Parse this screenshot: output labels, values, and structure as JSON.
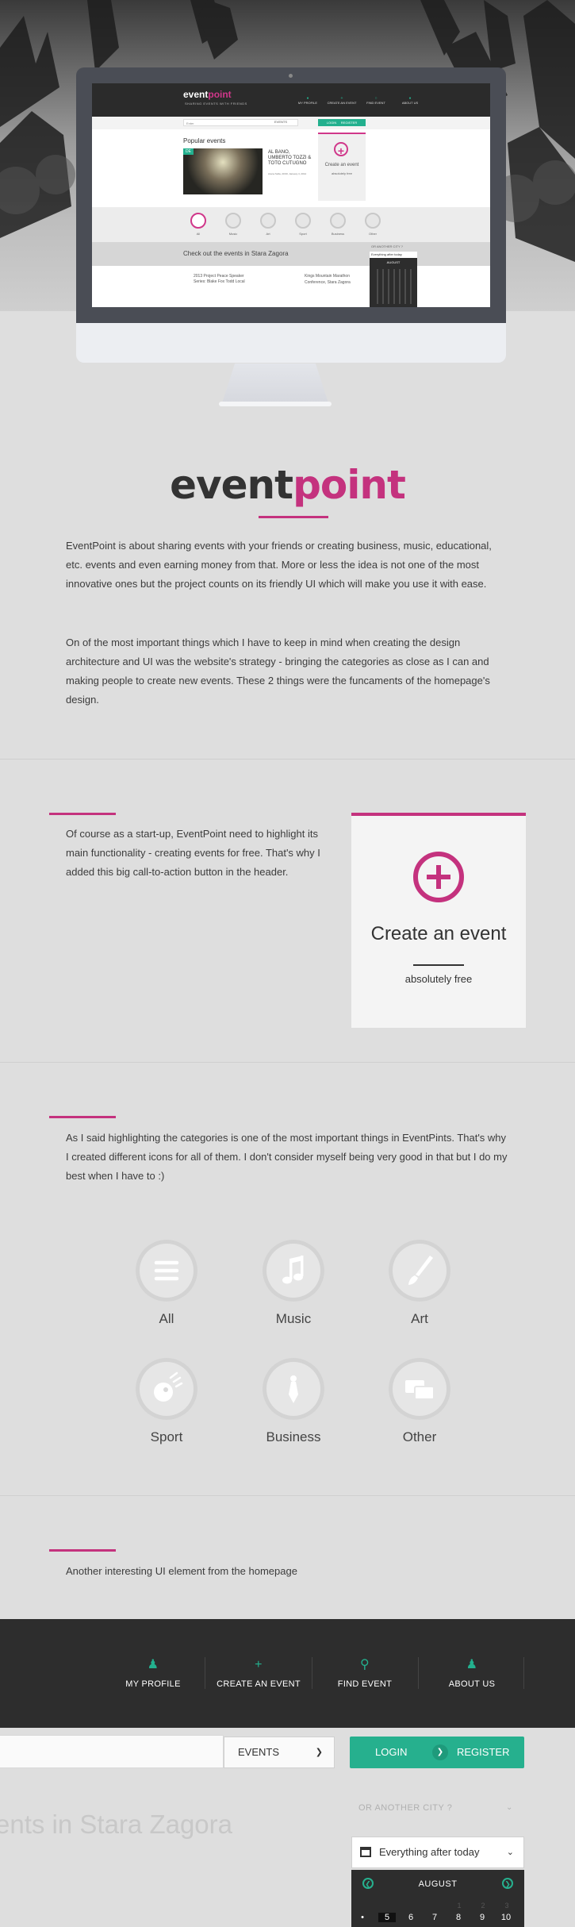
{
  "screen": {
    "logo_main": "event",
    "logo_accent": "point",
    "tagline": "SHARING EVENTS WITH FRIENDS",
    "nav": [
      {
        "label": "MY PROFILE"
      },
      {
        "label": "CREATE AN EVENT"
      },
      {
        "label": "FIND EVENT"
      },
      {
        "label": "ABOUT US"
      }
    ],
    "search_value": "Enter",
    "search_select": "EVENTS",
    "login": "LOGIN",
    "register": "REGISTER",
    "popular": "Popular events",
    "event_tag": "DE",
    "event_title": "AL BANO, UMBERTO TOZZI & TOTO CUTUGNO",
    "event_meta": "Arena Sofia, 20:00, January 4, 2014",
    "create_title": "Create an event",
    "create_sub": "absolutely free",
    "cats": [
      "All",
      "Music",
      "Art",
      "Sport",
      "Business",
      "Other"
    ],
    "check_out": "Check out the events in Stara Zagora",
    "city": "OR ANOTHER CITY ?",
    "date_label": "Everything after today",
    "month": "AUGUST",
    "list_1": "2013 Project Peace Speaker Series: Blake Fox Todd Local",
    "list_2": "Kings Mountain Marathon",
    "list_2b": "Conference, Stara Zagora"
  },
  "brand": {
    "main": "event",
    "accent": "point",
    "accent_color": "#c4327e",
    "green": "#26b08e"
  },
  "intro": {
    "p1": "EventPoint is about sharing events with your friends or creating business, music, educational, etc. events and even earning money from that. More or less the idea is not one of the most innovative ones but the project counts on its friendly UI which will make you use it with ease.",
    "p2": "On of the most important things which I have to keep in mind when creating the design architecture and UI was the website's strategy - bringing the categories as close as I can and making people to create new events. These 2 things were the funcaments of the homepage's design."
  },
  "cta_section": {
    "text": "Of course as a start-up, EventPoint need to highlight its main functionality - creating events for free. That's why I added this big call-to-action button in the header.",
    "card_title": "Create an event",
    "card_sub": "absolutely free"
  },
  "categories_section": {
    "text": "As I said highlighting the categories is one of the most important things in EventPints. That's why I created different icons for all of them. I don't consider myself being very good in that but I do my best when I have to :)",
    "items": [
      {
        "label": "All",
        "icon": "list-icon"
      },
      {
        "label": "Music",
        "icon": "music-note-icon"
      },
      {
        "label": "Art",
        "icon": "brush-icon"
      },
      {
        "label": "Sport",
        "icon": "ball-icon"
      },
      {
        "label": "Business",
        "icon": "tie-icon"
      },
      {
        "label": "Other",
        "icon": "chat-bubbles-icon"
      }
    ]
  },
  "ui_section": {
    "text": "Another interesting UI element from the homepage"
  },
  "footer_nav": [
    {
      "label": "MY PROFILE",
      "icon": "person-icon"
    },
    {
      "label": "CREATE AN EVENT",
      "icon": "plus-icon"
    },
    {
      "label": "FIND EVENT",
      "icon": "search-icon"
    },
    {
      "label": "ABOUT US",
      "icon": "person-icon"
    }
  ],
  "bottom": {
    "select_value": "EVENTS",
    "login": "LOGIN",
    "register": "REGISTER",
    "events_heading": "ents in Stara Zagora",
    "city": "OR ANOTHER CITY ?",
    "date_filter": "Everything after today",
    "month": "AUGUST",
    "days": [
      "5",
      "6",
      "7",
      "8",
      "9",
      "10"
    ],
    "faint_days": [
      "1",
      "2",
      "3"
    ]
  }
}
